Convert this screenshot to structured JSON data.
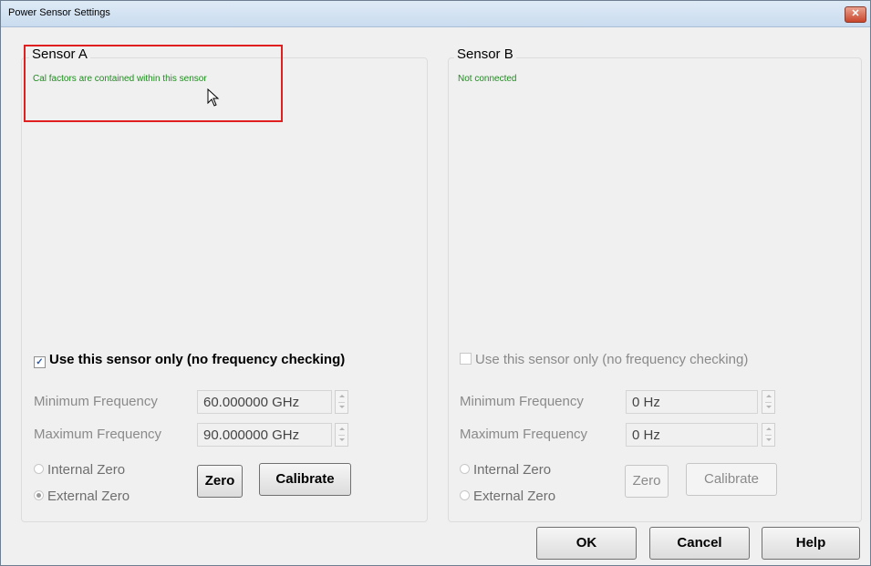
{
  "window": {
    "title": "Power Sensor Settings",
    "close_glyph": "✕"
  },
  "sensor_a": {
    "title": "Sensor A",
    "status": "Cal factors are contained within this sensor",
    "use_only_label": "Use this sensor only (no frequency checking)",
    "use_only_checked": true,
    "min_freq_label": "Minimum Frequency",
    "min_freq_value": "60.000000 GHz",
    "max_freq_label": "Maximum Frequency",
    "max_freq_value": "90.000000 GHz",
    "internal_zero_label": "Internal Zero",
    "external_zero_label": "External Zero",
    "selected_zero": "External Zero",
    "zero_button": "Zero",
    "calibrate_button": "Calibrate"
  },
  "sensor_b": {
    "title": "Sensor B",
    "status": "Not connected",
    "use_only_label": "Use this sensor only (no frequency checking)",
    "use_only_checked": false,
    "min_freq_label": "Minimum Frequency",
    "min_freq_value": "0 Hz",
    "max_freq_label": "Maximum Frequency",
    "max_freq_value": "0 Hz",
    "internal_zero_label": "Internal Zero",
    "external_zero_label": "External Zero",
    "zero_button": "Zero",
    "calibrate_button": "Calibrate"
  },
  "footer": {
    "ok_button": "OK",
    "cancel_button": "Cancel",
    "help_button": "Help"
  },
  "colors": {
    "status_text": "#1e8c1e",
    "highlight_border": "#e02020"
  }
}
